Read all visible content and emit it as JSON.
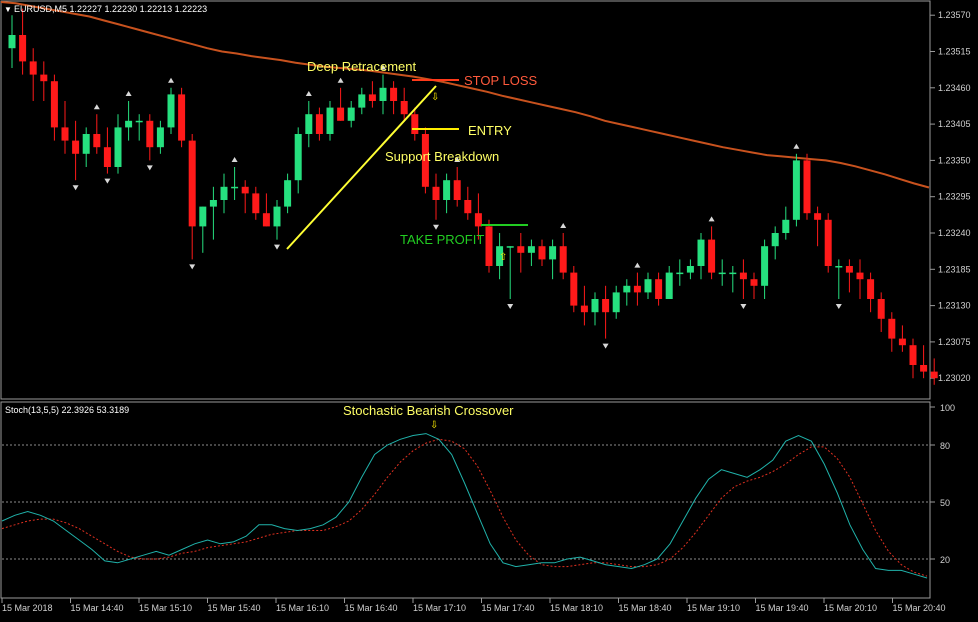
{
  "header": {
    "symbol_info": "EURUSD,M5  1.22227 1.22230 1.22213 1.22223",
    "stoch_info": "Stoch(13,5,5) 22.3926 53.3189"
  },
  "colors": {
    "bull": "#26e07f",
    "bear": "#ff1a1a",
    "ma": "#c8521e",
    "stoch_main": "#20b2aa",
    "stoch_signal": "#e03020",
    "annotation": "#ffff66",
    "stop": "#ff5a3c",
    "take_profit": "#22cc22"
  },
  "annotations": {
    "deep_retracement": "Deep Retracement",
    "stop_loss": "STOP LOSS",
    "entry": "ENTRY",
    "support_breakdown": "Support Breakdown",
    "take_profit": "TAKE PROFIT",
    "stoch_crossover": "Stochastic Bearish Crossover"
  },
  "chart_data": [
    {
      "type": "candlestick",
      "title": "EURUSD,M5",
      "y_ticks": [
        "1.23570",
        "1.23515",
        "1.23460",
        "1.23405",
        "1.23350",
        "1.23295",
        "1.23240",
        "1.23185",
        "1.23130",
        "1.23075",
        "1.23020"
      ],
      "ylim": [
        1.2299,
        1.2359
      ],
      "ma_values": [
        1.2359,
        1.23588,
        1.23584,
        1.2358,
        1.23576,
        1.23572,
        1.23568,
        1.23562,
        1.23556,
        1.2355,
        1.23544,
        1.23538,
        1.23532,
        1.23526,
        1.2352,
        1.23515,
        1.23512,
        1.23508,
        1.23505,
        1.23502,
        1.23498,
        1.23495,
        1.23492,
        1.2349,
        1.23488,
        1.23486,
        1.23483,
        1.2348,
        1.23477,
        1.23473,
        1.23469,
        1.23464,
        1.23459,
        1.23454,
        1.23448,
        1.23443,
        1.23438,
        1.23433,
        1.23428,
        1.23423,
        1.23417,
        1.2341,
        1.23405,
        1.234,
        1.23395,
        1.2339,
        1.23385,
        1.2338,
        1.23375,
        1.2337,
        1.23366,
        1.23362,
        1.23358,
        1.23356,
        1.23354,
        1.23352,
        1.2335,
        1.23346,
        1.23341,
        1.23335,
        1.23329,
        1.23322,
        1.23315,
        1.23309
      ],
      "candles": [
        {
          "o": 1.2352,
          "h": 1.2357,
          "l": 1.2349,
          "c": 1.2354
        },
        {
          "o": 1.2354,
          "h": 1.2358,
          "l": 1.2348,
          "c": 1.235
        },
        {
          "o": 1.235,
          "h": 1.2352,
          "l": 1.2344,
          "c": 1.2348
        },
        {
          "o": 1.2348,
          "h": 1.235,
          "l": 1.2344,
          "c": 1.2347
        },
        {
          "o": 1.2347,
          "h": 1.2348,
          "l": 1.2338,
          "c": 1.234
        },
        {
          "o": 1.234,
          "h": 1.2344,
          "l": 1.2336,
          "c": 1.2338
        },
        {
          "o": 1.2338,
          "h": 1.2341,
          "l": 1.2332,
          "c": 1.2336
        },
        {
          "o": 1.2336,
          "h": 1.234,
          "l": 1.2334,
          "c": 1.2339
        },
        {
          "o": 1.2339,
          "h": 1.2342,
          "l": 1.2336,
          "c": 1.2337
        },
        {
          "o": 1.2337,
          "h": 1.234,
          "l": 1.2333,
          "c": 1.2334
        },
        {
          "o": 1.2334,
          "h": 1.2342,
          "l": 1.2333,
          "c": 1.234
        },
        {
          "o": 1.234,
          "h": 1.2344,
          "l": 1.2338,
          "c": 1.2341
        },
        {
          "o": 1.2341,
          "h": 1.2342,
          "l": 1.2338,
          "c": 1.2341
        },
        {
          "o": 1.2341,
          "h": 1.2342,
          "l": 1.2335,
          "c": 1.2337
        },
        {
          "o": 1.2337,
          "h": 1.2341,
          "l": 1.2336,
          "c": 1.234
        },
        {
          "o": 1.234,
          "h": 1.2346,
          "l": 1.2339,
          "c": 1.2345
        },
        {
          "o": 1.2345,
          "h": 1.2346,
          "l": 1.2337,
          "c": 1.2338
        },
        {
          "o": 1.2338,
          "h": 1.2339,
          "l": 1.232,
          "c": 1.2325
        },
        {
          "o": 1.2325,
          "h": 1.2328,
          "l": 1.2321,
          "c": 1.2328
        },
        {
          "o": 1.2328,
          "h": 1.2331,
          "l": 1.2323,
          "c": 1.2329
        },
        {
          "o": 1.2329,
          "h": 1.2333,
          "l": 1.2327,
          "c": 1.2331
        },
        {
          "o": 1.2331,
          "h": 1.2334,
          "l": 1.2329,
          "c": 1.2331
        },
        {
          "o": 1.2331,
          "h": 1.2332,
          "l": 1.2327,
          "c": 1.233
        },
        {
          "o": 1.233,
          "h": 1.2331,
          "l": 1.2326,
          "c": 1.2327
        },
        {
          "o": 1.2327,
          "h": 1.233,
          "l": 1.2325,
          "c": 1.2325
        },
        {
          "o": 1.2325,
          "h": 1.2329,
          "l": 1.2323,
          "c": 1.2328
        },
        {
          "o": 1.2328,
          "h": 1.2333,
          "l": 1.2327,
          "c": 1.2332
        },
        {
          "o": 1.2332,
          "h": 1.234,
          "l": 1.233,
          "c": 1.2339
        },
        {
          "o": 1.2339,
          "h": 1.2344,
          "l": 1.2337,
          "c": 1.2342
        },
        {
          "o": 1.2342,
          "h": 1.2343,
          "l": 1.2338,
          "c": 1.2339
        },
        {
          "o": 1.2339,
          "h": 1.2344,
          "l": 1.2338,
          "c": 1.2343
        },
        {
          "o": 1.2343,
          "h": 1.2346,
          "l": 1.2341,
          "c": 1.2341
        },
        {
          "o": 1.2341,
          "h": 1.2344,
          "l": 1.234,
          "c": 1.2343
        },
        {
          "o": 1.2343,
          "h": 1.2346,
          "l": 1.2342,
          "c": 1.2345
        },
        {
          "o": 1.2345,
          "h": 1.2347,
          "l": 1.2343,
          "c": 1.2344
        },
        {
          "o": 1.2344,
          "h": 1.2348,
          "l": 1.2342,
          "c": 1.2346
        },
        {
          "o": 1.2346,
          "h": 1.2347,
          "l": 1.2342,
          "c": 1.2344
        },
        {
          "o": 1.2344,
          "h": 1.2346,
          "l": 1.2341,
          "c": 1.2342
        },
        {
          "o": 1.2342,
          "h": 1.2343,
          "l": 1.2338,
          "c": 1.2339
        },
        {
          "o": 1.2339,
          "h": 1.234,
          "l": 1.233,
          "c": 1.2331
        },
        {
          "o": 1.2331,
          "h": 1.2333,
          "l": 1.2326,
          "c": 1.2329
        },
        {
          "o": 1.2329,
          "h": 1.2333,
          "l": 1.2327,
          "c": 1.2332
        },
        {
          "o": 1.2332,
          "h": 1.2334,
          "l": 1.2328,
          "c": 1.2329
        },
        {
          "o": 1.2329,
          "h": 1.2331,
          "l": 1.2326,
          "c": 1.2327
        },
        {
          "o": 1.2327,
          "h": 1.233,
          "l": 1.2323,
          "c": 1.2325
        },
        {
          "o": 1.2325,
          "h": 1.2326,
          "l": 1.2318,
          "c": 1.2319
        },
        {
          "o": 1.2319,
          "h": 1.2324,
          "l": 1.2317,
          "c": 1.2322
        },
        {
          "o": 1.2322,
          "h": 1.2322,
          "l": 1.2314,
          "c": 1.2322
        },
        {
          "o": 1.2322,
          "h": 1.2324,
          "l": 1.2318,
          "c": 1.2321
        },
        {
          "o": 1.2321,
          "h": 1.2323,
          "l": 1.2319,
          "c": 1.2322
        },
        {
          "o": 1.2322,
          "h": 1.2323,
          "l": 1.2319,
          "c": 1.232
        },
        {
          "o": 1.232,
          "h": 1.2323,
          "l": 1.2317,
          "c": 1.2322
        },
        {
          "o": 1.2322,
          "h": 1.2324,
          "l": 1.2317,
          "c": 1.2318
        },
        {
          "o": 1.2318,
          "h": 1.2319,
          "l": 1.2312,
          "c": 1.2313
        },
        {
          "o": 1.2313,
          "h": 1.2316,
          "l": 1.231,
          "c": 1.2312
        },
        {
          "o": 1.2312,
          "h": 1.2315,
          "l": 1.231,
          "c": 1.2314
        },
        {
          "o": 1.2314,
          "h": 1.2316,
          "l": 1.2308,
          "c": 1.2312
        },
        {
          "o": 1.2312,
          "h": 1.2316,
          "l": 1.2311,
          "c": 1.2315
        },
        {
          "o": 1.2315,
          "h": 1.2317,
          "l": 1.2313,
          "c": 1.2316
        },
        {
          "o": 1.2316,
          "h": 1.2318,
          "l": 1.2313,
          "c": 1.2315
        },
        {
          "o": 1.2315,
          "h": 1.2318,
          "l": 1.2314,
          "c": 1.2317
        },
        {
          "o": 1.2317,
          "h": 1.2318,
          "l": 1.2313,
          "c": 1.2314
        },
        {
          "o": 1.2314,
          "h": 1.2319,
          "l": 1.2314,
          "c": 1.2318
        },
        {
          "o": 1.2318,
          "h": 1.232,
          "l": 1.2316,
          "c": 1.2318
        },
        {
          "o": 1.2318,
          "h": 1.232,
          "l": 1.2317,
          "c": 1.2319
        },
        {
          "o": 1.2319,
          "h": 1.2324,
          "l": 1.2317,
          "c": 1.2323
        },
        {
          "o": 1.2323,
          "h": 1.2325,
          "l": 1.2317,
          "c": 1.2318
        },
        {
          "o": 1.2318,
          "h": 1.232,
          "l": 1.2316,
          "c": 1.2318
        },
        {
          "o": 1.2318,
          "h": 1.2319,
          "l": 1.2315,
          "c": 1.2318
        },
        {
          "o": 1.2318,
          "h": 1.232,
          "l": 1.2314,
          "c": 1.2317
        },
        {
          "o": 1.2317,
          "h": 1.2318,
          "l": 1.2314,
          "c": 1.2316
        },
        {
          "o": 1.2316,
          "h": 1.2323,
          "l": 1.2314,
          "c": 1.2322
        },
        {
          "o": 1.2322,
          "h": 1.2325,
          "l": 1.232,
          "c": 1.2324
        },
        {
          "o": 1.2324,
          "h": 1.2328,
          "l": 1.2323,
          "c": 1.2326
        },
        {
          "o": 1.2326,
          "h": 1.2336,
          "l": 1.2325,
          "c": 1.2335
        },
        {
          "o": 1.2335,
          "h": 1.2336,
          "l": 1.2326,
          "c": 1.2327
        },
        {
          "o": 1.2327,
          "h": 1.2328,
          "l": 1.2322,
          "c": 1.2326
        },
        {
          "o": 1.2326,
          "h": 1.2327,
          "l": 1.2318,
          "c": 1.2319
        },
        {
          "o": 1.2319,
          "h": 1.232,
          "l": 1.2314,
          "c": 1.2319
        },
        {
          "o": 1.2319,
          "h": 1.232,
          "l": 1.2315,
          "c": 1.2318
        },
        {
          "o": 1.2318,
          "h": 1.232,
          "l": 1.2314,
          "c": 1.2317
        },
        {
          "o": 1.2317,
          "h": 1.2318,
          "l": 1.2312,
          "c": 1.2314
        },
        {
          "o": 1.2314,
          "h": 1.2315,
          "l": 1.2309,
          "c": 1.2311
        },
        {
          "o": 1.2311,
          "h": 1.2312,
          "l": 1.2306,
          "c": 1.2308
        },
        {
          "o": 1.2308,
          "h": 1.231,
          "l": 1.2306,
          "c": 1.2307
        },
        {
          "o": 1.2307,
          "h": 1.2308,
          "l": 1.2302,
          "c": 1.2304
        },
        {
          "o": 1.2304,
          "h": 1.2307,
          "l": 1.2302,
          "c": 1.2303
        },
        {
          "o": 1.2303,
          "h": 1.2305,
          "l": 1.2301,
          "c": 1.2302
        }
      ]
    },
    {
      "type": "line",
      "title": "Stoch(13,5,5)",
      "ylim": [
        0,
        100
      ],
      "y_ticks": [
        "100",
        "80",
        "50",
        "20",
        "0"
      ],
      "x_ticks": [
        "15 Mar 2018",
        "15 Mar 14:40",
        "15 Mar 15:10",
        "15 Mar 15:40",
        "15 Mar 16:10",
        "15 Mar 16:40",
        "15 Mar 17:10",
        "15 Mar 17:40",
        "15 Mar 18:10",
        "15 Mar 18:40",
        "15 Mar 19:10",
        "15 Mar 19:40",
        "15 Mar 20:10",
        "15 Mar 20:40"
      ],
      "series": [
        {
          "values": [
            40,
            43,
            45,
            43,
            40,
            35,
            30,
            25,
            19,
            18,
            20,
            22,
            24,
            22,
            25,
            28,
            30,
            28,
            29,
            32,
            38,
            38,
            36,
            35,
            36,
            38,
            42,
            50,
            63,
            75,
            80,
            83,
            85,
            86,
            83,
            75,
            60,
            44,
            28,
            18,
            16,
            17,
            18,
            18,
            20,
            21,
            19,
            17,
            16,
            15,
            17,
            20,
            28,
            40,
            52,
            62,
            67,
            65,
            63,
            67,
            72,
            82,
            85,
            82,
            70,
            55,
            38,
            25,
            15,
            14,
            14,
            12,
            10
          ]
        },
        {
          "values": [
            36,
            38,
            40,
            41,
            41,
            39,
            36,
            32,
            28,
            24,
            21,
            20,
            20,
            21,
            23,
            24,
            26,
            27,
            28,
            29,
            31,
            33,
            34,
            35,
            35,
            35,
            37,
            40,
            46,
            54,
            63,
            71,
            77,
            81,
            83,
            82,
            78,
            69,
            56,
            42,
            30,
            22,
            17,
            16,
            16,
            17,
            18,
            18,
            17,
            16,
            16,
            17,
            20,
            26,
            34,
            43,
            52,
            58,
            61,
            63,
            66,
            70,
            75,
            79,
            79,
            73,
            63,
            49,
            35,
            24,
            17,
            13,
            11
          ]
        }
      ]
    }
  ]
}
